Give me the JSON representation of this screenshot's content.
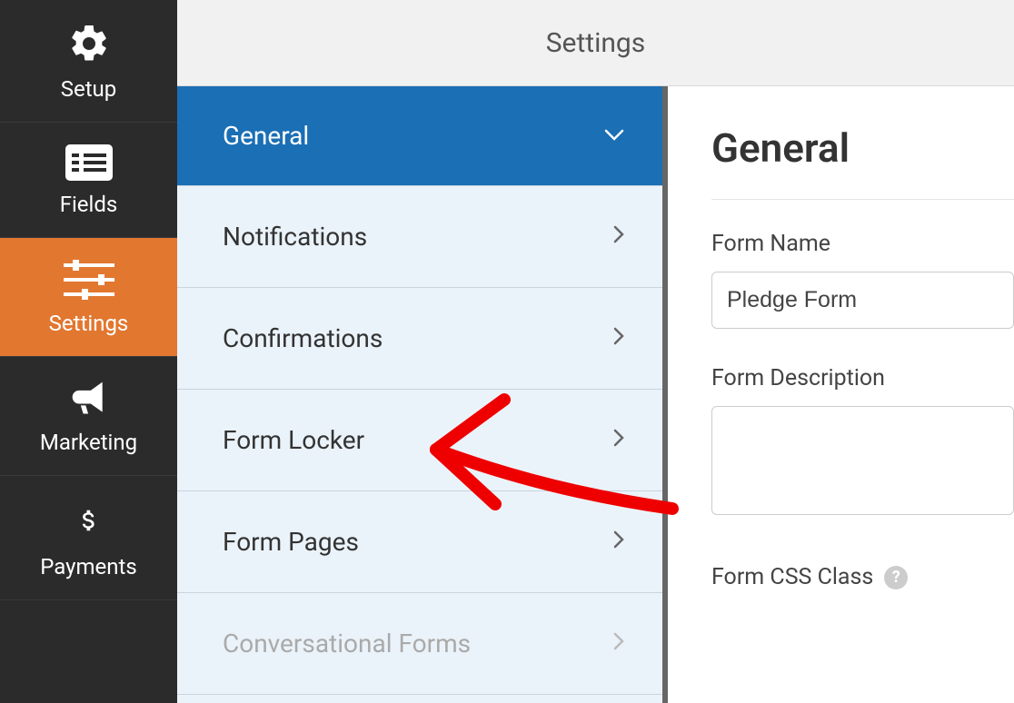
{
  "sidebar": {
    "items": [
      {
        "label": "Setup"
      },
      {
        "label": "Fields"
      },
      {
        "label": "Settings"
      },
      {
        "label": "Marketing"
      },
      {
        "label": "Payments"
      }
    ]
  },
  "header": {
    "title": "Settings"
  },
  "settingsPanel": {
    "items": [
      {
        "label": "General"
      },
      {
        "label": "Notifications"
      },
      {
        "label": "Confirmations"
      },
      {
        "label": "Form Locker"
      },
      {
        "label": "Form Pages"
      },
      {
        "label": "Conversational Forms"
      }
    ]
  },
  "form": {
    "heading": "General",
    "nameLabel": "Form Name",
    "nameValue": "Pledge Form",
    "descLabel": "Form Description",
    "descValue": "",
    "cssLabel": "Form CSS Class"
  }
}
